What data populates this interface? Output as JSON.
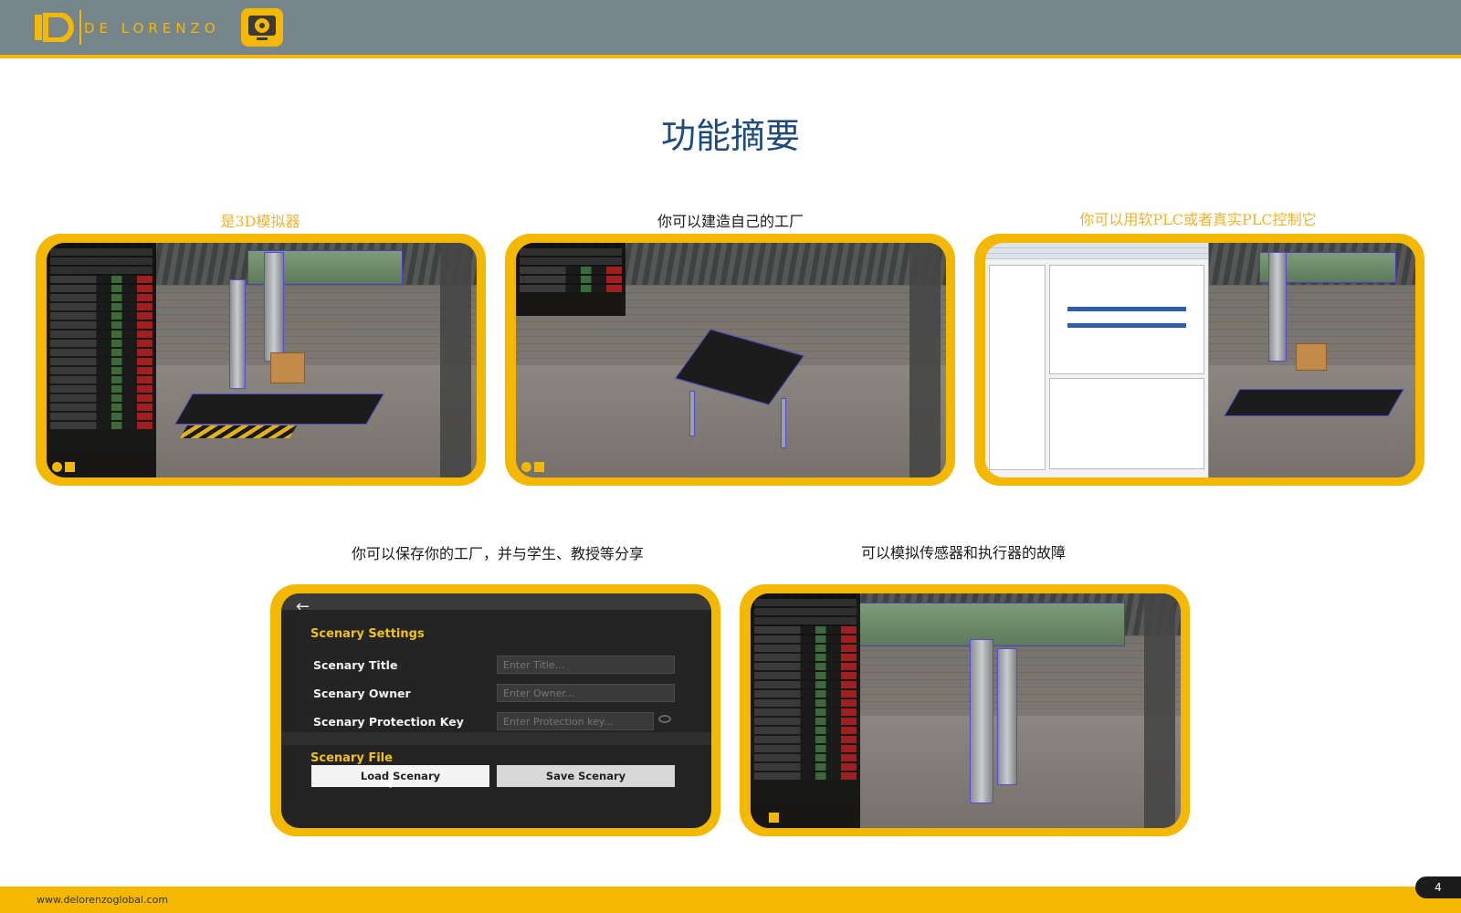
{
  "header": {
    "brand": "DE LORENZO",
    "logo_icon": "dl-logo-icon",
    "app_icon": "gear-monitor-icon",
    "accent": "#f5b800",
    "bar_color": "#76858b"
  },
  "title": "功能摘要",
  "captions": [
    "是3D模拟器",
    "你可以建造自己的工厂",
    "你可以用软PLC或者真实PLC控制它",
    "你可以保存你的工厂，并与学生、教授等分享",
    "可以模拟传感器和执行器的故障"
  ],
  "scenario_settings": {
    "section_title": "Scenary Settings",
    "fields": [
      {
        "label": "Scenary Title",
        "placeholder": "Enter Title..."
      },
      {
        "label": "Scenary Owner",
        "placeholder": "Enter Owner..."
      },
      {
        "label": "Scenary Protection Key",
        "placeholder": "Enter Protection key..."
      }
    ],
    "file_title": "Scenary File",
    "load_button": "Load Scenary",
    "save_button": "Save Scenary"
  },
  "footer": {
    "url": "www.delorenzoglobal.com",
    "page_number": "4"
  }
}
